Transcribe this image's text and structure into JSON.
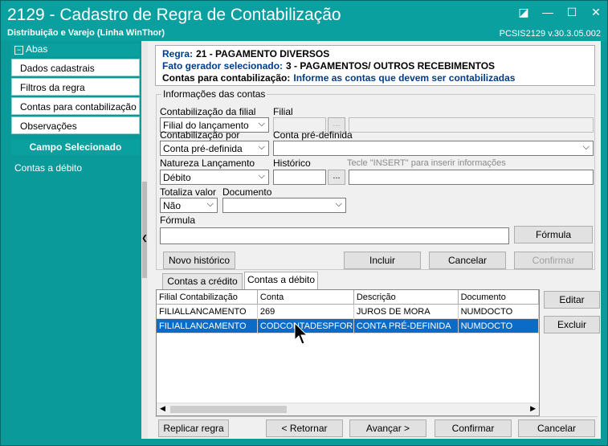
{
  "window": {
    "title": "2129 - Cadastro de Regra de Contabilização",
    "subtitle": "Distribuição e Varejo (Linha WinThor)",
    "version": "PCSIS2129  v.30.3.05.002",
    "controls": [
      "◪",
      "—",
      "☐",
      "✕"
    ]
  },
  "sidebar": {
    "header": "Abas",
    "items": [
      {
        "label": "Dados cadastrais"
      },
      {
        "label": "Filtros da regra"
      },
      {
        "label": "Contas para contabilização"
      },
      {
        "label": "Observações"
      }
    ],
    "selected_header": "Campo Selecionado",
    "selected_value": "Contas a débito"
  },
  "info": {
    "regra_label": "Regra:",
    "regra_value": "21 - PAGAMENTO DIVERSOS",
    "fato_label": "Fato gerador selecionado:",
    "fato_value": "3 - PAGAMENTOS/ OUTROS RECEBIMENTOS",
    "contas_label": "Contas para contabilização:",
    "contas_value": "Informe as contas que devem ser contabilizadas"
  },
  "form": {
    "group_title": "Informações das contas",
    "contab_filial_label": "Contabilização da filial",
    "contab_filial_value": "Filial do lançamento",
    "filial_label": "Filial",
    "contab_por_label": "Contabilização por",
    "contab_por_value": "Conta pré-definida",
    "conta_pre_label": "Conta pré-definida",
    "natureza_label": "Natureza Lançamento",
    "natureza_value": "Débito",
    "historico_label": "Histórico",
    "historico_hint": "Tecle  \"INSERT\" para inserir informações",
    "totaliza_label": "Totaliza valor",
    "totaliza_value": "Não",
    "documento_label": "Documento",
    "formula_label": "Fórmula",
    "formula_button": "Fórmula",
    "dots": "...",
    "arrow": "⌵"
  },
  "actions": {
    "novo_historico": "Novo histórico",
    "incluir": "Incluir",
    "cancelar": "Cancelar",
    "confirmar": "Confirmar"
  },
  "tabs": [
    {
      "label": "Contas a crédito"
    },
    {
      "label": "Contas a débito"
    }
  ],
  "grid": {
    "columns": [
      "Filial Contabilização",
      "Conta",
      "Descrição",
      "Documento"
    ],
    "rows": [
      [
        "FILIALLANCAMENTO",
        "269",
        "JUROS DE MORA",
        "NUMDOCTO"
      ],
      [
        "FILIALLANCAMENTO",
        "CODCONTADESPFORNEC",
        "CONTA PRÉ-DEFINIDA",
        "NUMDOCTO"
      ]
    ],
    "editar": "Editar",
    "excluir": "Excluir"
  },
  "footer": {
    "replicar": "Replicar regra",
    "retornar": "< Retornar",
    "avancar": "Avançar >",
    "confirmar": "Confirmar",
    "cancelar": "Cancelar"
  }
}
